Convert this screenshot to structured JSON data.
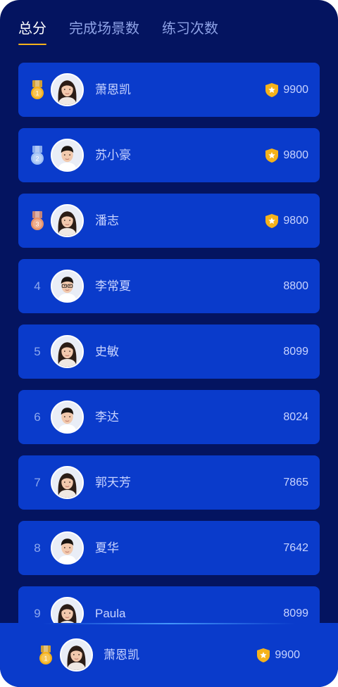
{
  "tabs": [
    {
      "label": "总分",
      "active": true
    },
    {
      "label": "完成场景数",
      "active": false
    },
    {
      "label": "练习次数",
      "active": false
    }
  ],
  "rows": [
    {
      "rank": "1",
      "medal": "gold",
      "name": "萧恩凯",
      "score": "9900",
      "badge": true,
      "gender": "female"
    },
    {
      "rank": "2",
      "medal": "silver",
      "name": "苏小豪",
      "score": "9800",
      "badge": true,
      "gender": "male"
    },
    {
      "rank": "3",
      "medal": "bronze",
      "name": "潘志",
      "score": "9800",
      "badge": true,
      "gender": "female"
    },
    {
      "rank": "4",
      "medal": "",
      "name": "李常夏",
      "score": "8800",
      "badge": false,
      "gender": "male-glasses"
    },
    {
      "rank": "5",
      "medal": "",
      "name": "史敏",
      "score": "8099",
      "badge": false,
      "gender": "female"
    },
    {
      "rank": "6",
      "medal": "",
      "name": "李达",
      "score": "8024",
      "badge": false,
      "gender": "male"
    },
    {
      "rank": "7",
      "medal": "",
      "name": "郭天芳",
      "score": "7865",
      "badge": false,
      "gender": "female"
    },
    {
      "rank": "8",
      "medal": "",
      "name": "夏华",
      "score": "7642",
      "badge": false,
      "gender": "male"
    },
    {
      "rank": "9",
      "medal": "",
      "name": "Paula",
      "score": "8099",
      "badge": false,
      "gender": "female"
    }
  ],
  "me": {
    "rank": "1",
    "medal": "gold",
    "name": "萧恩凯",
    "score": "9900",
    "badge": true,
    "gender": "female"
  },
  "icons": {
    "medal": "medal-icon",
    "badge": "shield-star-icon",
    "avatar": "avatar-icon"
  },
  "colors": {
    "background": "#041460",
    "row": "#0a3bcb",
    "accent": "#f5b21b",
    "gold": "#f5b21b",
    "silver": "#9fc0f5",
    "bronze": "#e8936a",
    "text": "#c9d4ff"
  }
}
